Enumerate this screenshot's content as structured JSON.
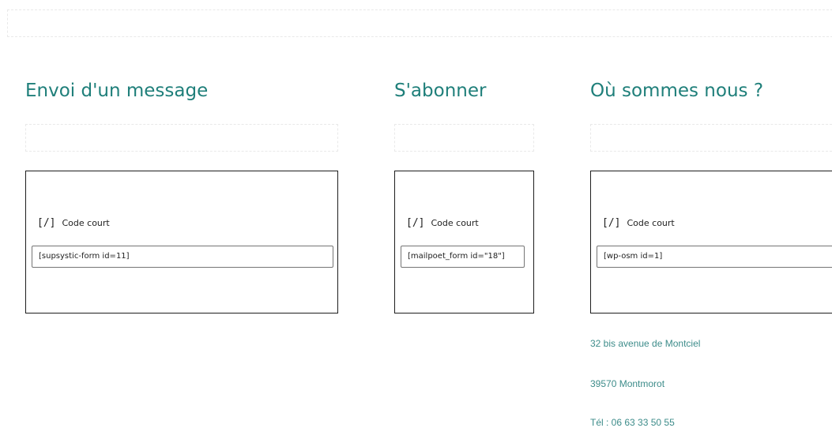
{
  "columns": {
    "message": {
      "title": "Envoi d'un message",
      "block_label": "Code court",
      "icon": "shortcode-icon",
      "icon_glyph": "[/]",
      "shortcode": "[supsystic-form id=11]"
    },
    "subscribe": {
      "title": "S'abonner",
      "block_label": "Code court",
      "icon": "shortcode-icon",
      "icon_glyph": "[/]",
      "shortcode": "[mailpoet_form id=\"18\"]"
    },
    "location": {
      "title": "Où sommes nous ?",
      "block_label": "Code court",
      "icon": "shortcode-icon",
      "icon_glyph": "[/]",
      "shortcode": "[wp-osm id=1]"
    }
  },
  "address": {
    "street": "32 bis avenue de Montciel",
    "city": "39570 Montmorot",
    "phone": "Tél : 06 63 33 50 55"
  },
  "colors": {
    "heading": "#1f7f7a",
    "address_text": "#3d8c8a",
    "block_border": "#1e1e1e"
  }
}
